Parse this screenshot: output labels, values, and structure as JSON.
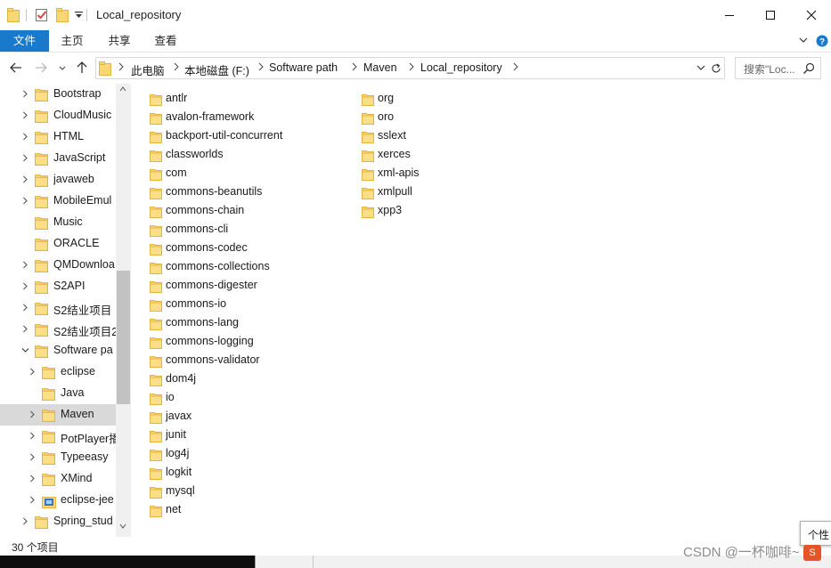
{
  "window": {
    "title": "Local_repository"
  },
  "ribbon": {
    "tabs": [
      "文件",
      "主页",
      "共享",
      "查看"
    ]
  },
  "address": {
    "breadcrumbs": [
      "此电脑",
      "本地磁盘 (F:)",
      "Software path",
      "Maven",
      "Local_repository"
    ]
  },
  "search": {
    "placeholder": "搜索\"Loc..."
  },
  "nav": {
    "items": [
      {
        "label": "Bootstrap",
        "indent": 0,
        "expandable": true
      },
      {
        "label": "CloudMusic",
        "indent": 0,
        "expandable": true
      },
      {
        "label": "HTML",
        "indent": 0,
        "expandable": true
      },
      {
        "label": "JavaScript",
        "indent": 0,
        "expandable": true
      },
      {
        "label": "javaweb",
        "indent": 0,
        "expandable": true
      },
      {
        "label": "MobileEmul",
        "indent": 0,
        "expandable": true
      },
      {
        "label": "Music",
        "indent": 0,
        "expandable": false
      },
      {
        "label": "ORACLE",
        "indent": 0,
        "expandable": false
      },
      {
        "label": "QMDownloa",
        "indent": 0,
        "expandable": true
      },
      {
        "label": "S2API",
        "indent": 0,
        "expandable": true
      },
      {
        "label": "S2结业项目",
        "indent": 0,
        "expandable": true
      },
      {
        "label": "S2结业项目2",
        "indent": 0,
        "expandable": true
      },
      {
        "label": "Software pa",
        "indent": 0,
        "expandable": true,
        "expanded": true
      },
      {
        "label": "eclipse",
        "indent": 1,
        "expandable": true
      },
      {
        "label": "Java",
        "indent": 1,
        "expandable": false
      },
      {
        "label": "Maven",
        "indent": 1,
        "expandable": true,
        "selected": true
      },
      {
        "label": "PotPlayer播",
        "indent": 1,
        "expandable": true
      },
      {
        "label": "Typeeasy",
        "indent": 1,
        "expandable": true
      },
      {
        "label": "XMind",
        "indent": 1,
        "expandable": true
      },
      {
        "label": "eclipse-jee",
        "indent": 1,
        "expandable": true,
        "special": true
      },
      {
        "label": "Spring_stud",
        "indent": 0,
        "expandable": true
      }
    ]
  },
  "files": {
    "column1": [
      "antlr",
      "avalon-framework",
      "backport-util-concurrent",
      "classworlds",
      "com",
      "commons-beanutils",
      "commons-chain",
      "commons-cli",
      "commons-codec",
      "commons-collections",
      "commons-digester",
      "commons-io",
      "commons-lang",
      "commons-logging",
      "commons-validator",
      "dom4j",
      "io",
      "javax",
      "junit",
      "log4j",
      "logkit",
      "mysql",
      "net"
    ],
    "column2": [
      "org",
      "oro",
      "sslext",
      "xerces",
      "xml-apis",
      "xmlpull",
      "xpp3"
    ]
  },
  "status": {
    "item_count": "30 个项目"
  },
  "overlay": {
    "popup_text": "个性",
    "watermark": "CSDN @一杯咖啡~",
    "tray_badge": "S"
  },
  "colors": {
    "accent": "#1979ca",
    "folder": "#f8d775",
    "folder_dark": "#e3b443",
    "selected": "#d9d9d9"
  }
}
